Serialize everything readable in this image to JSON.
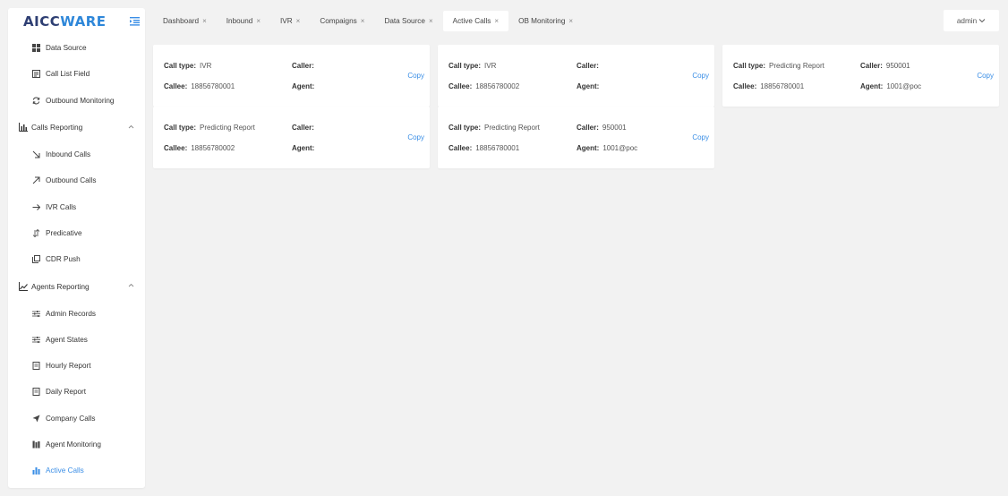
{
  "app": {
    "logo_main": "AICC",
    "logo_accent": "WARE"
  },
  "sidebar": {
    "items_top": [
      {
        "label": "Data Source",
        "icon": "grid-icon"
      },
      {
        "label": "Call List Field",
        "icon": "list-icon"
      },
      {
        "label": "Outbound Monitoring",
        "icon": "refresh-icon"
      }
    ],
    "group_calls": {
      "label": "Calls Reporting",
      "icon": "bar-chart-icon"
    },
    "items_calls": [
      {
        "label": "Inbound Calls",
        "icon": "arrow-down-right-icon"
      },
      {
        "label": "Outbound Calls",
        "icon": "arrow-up-right-icon"
      },
      {
        "label": "IVR Calls",
        "icon": "arrow-right-icon"
      },
      {
        "label": "Predicative",
        "icon": "sort-icon"
      },
      {
        "label": "CDR Push",
        "icon": "copy-icon"
      }
    ],
    "group_agents": {
      "label": "Agents Reporting",
      "icon": "line-chart-icon"
    },
    "items_agents": [
      {
        "label": "Admin Records",
        "icon": "sliders-icon"
      },
      {
        "label": "Agent States",
        "icon": "sliders-icon"
      },
      {
        "label": "Hourly Report",
        "icon": "document-icon"
      },
      {
        "label": "Daily Report",
        "icon": "document-icon"
      },
      {
        "label": "Company Calls",
        "icon": "send-icon"
      },
      {
        "label": "Agent Monitoring",
        "icon": "columns-icon"
      },
      {
        "label": "Active Calls",
        "icon": "bars-icon"
      }
    ]
  },
  "tabs": [
    {
      "label": "Dashboard",
      "close": "×"
    },
    {
      "label": "Inbound",
      "close": "×"
    },
    {
      "label": "IVR",
      "close": "×"
    },
    {
      "label": "Compaigns",
      "close": "×"
    },
    {
      "label": "Data Source",
      "close": "×"
    },
    {
      "label": "Active Calls",
      "close": "×"
    },
    {
      "label": "OB Monitoring",
      "close": "×"
    }
  ],
  "user": {
    "name": "admin"
  },
  "labels": {
    "call_type": "Call type:",
    "caller": "Caller:",
    "callee": "Callee:",
    "agent": "Agent:",
    "copy": "Copy"
  },
  "cards": [
    {
      "call_type": "IVR",
      "caller": "",
      "callee": "18856780001",
      "agent": ""
    },
    {
      "call_type": "IVR",
      "caller": "",
      "callee": "18856780002",
      "agent": ""
    },
    {
      "call_type": "Predicting Report",
      "caller": "950001",
      "callee": "18856780001",
      "agent": "1001@poc"
    },
    {
      "call_type": "Predicting Report",
      "caller": "",
      "callee": "18856780002",
      "agent": ""
    },
    {
      "call_type": "Predicting Report",
      "caller": "950001",
      "callee": "18856780001",
      "agent": "1001@poc"
    }
  ],
  "colors": {
    "accent": "#3a8ee6",
    "logo": "#2e3f73",
    "background": "#f2f2f2"
  }
}
